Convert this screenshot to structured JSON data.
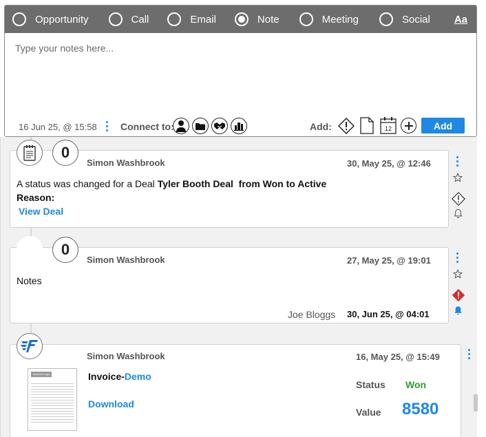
{
  "activity_types": [
    {
      "label": "Opportunity",
      "selected": false
    },
    {
      "label": "Call",
      "selected": false
    },
    {
      "label": "Email",
      "selected": false
    },
    {
      "label": "Note",
      "selected": true
    },
    {
      "label": "Meeting",
      "selected": false
    },
    {
      "label": "Social",
      "selected": false
    }
  ],
  "font_toggle": "Aa",
  "composer": {
    "placeholder": "Type your notes here...",
    "timestamp": "16 Jun 25, @ 15:58",
    "connect_label": "Connect to:",
    "connect_icons": [
      "contact-icon",
      "folder-icon",
      "handshake-icon",
      "company-icon"
    ],
    "add_label": "Add:",
    "add_icons": [
      "priority-icon",
      "document-icon",
      "calendar-icon",
      "plus-icon"
    ],
    "calendar_day": "12",
    "add_button": "Add"
  },
  "feed": [
    {
      "badge": "0",
      "author": "Simon Washbrook",
      "date": "30, May 25, @ 12:46",
      "text_prefix": "A status was changed for a Deal ",
      "deal_name": "Tyler Booth Deal",
      "text_suffix": "  from Won to Active",
      "reason_label": "Reason:",
      "link": "View Deal",
      "icon": "notepad-icon"
    },
    {
      "badge": "0",
      "author": "Simon Washbrook",
      "date": "27, May 25, @ 19:01",
      "text": "Notes",
      "assignee": "Joe Bloggs",
      "due": "30, Jun 25, @ 04:01",
      "priority_color": "#d32f2f",
      "bell_color": "#1e88e5"
    },
    {
      "author": "Simon Washbrook",
      "date": "16, May 25, @ 15:49",
      "invoice_prefix": "Invoice-",
      "invoice_link": "Demo",
      "download": "Download",
      "status_label": "Status",
      "status_value": "Won",
      "value_label": "Value",
      "value": "8580",
      "icon": "brand-f-icon",
      "thumb_logo_text": "Area for Logo"
    }
  ],
  "colors": {
    "accent": "#1e88e5",
    "won": "#2e9d2e",
    "header_bar": "#6d6d6d"
  }
}
